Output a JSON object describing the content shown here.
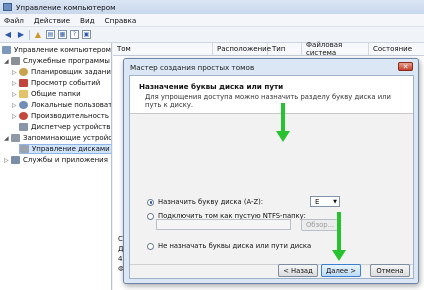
{
  "window": {
    "title": "Управление компьютером"
  },
  "menu": [
    "Файл",
    "Действие",
    "Вид",
    "Справка"
  ],
  "tree": {
    "root": "Управление компьютером (л",
    "items": [
      {
        "label": "Служебные программы"
      },
      {
        "label": "Планировщик заданий"
      },
      {
        "label": "Просмотр событий"
      },
      {
        "label": "Общие папки"
      },
      {
        "label": "Локальные пользовате"
      },
      {
        "label": "Производительность"
      },
      {
        "label": "Диспетчер устройств"
      },
      {
        "label": "Запоминающие устройст"
      },
      {
        "label": "Управление дисками"
      },
      {
        "label": "Службы и приложения"
      }
    ]
  },
  "columns": [
    "Том",
    "Расположение",
    "Тип",
    "Файловая система",
    "Состояние"
  ],
  "lower_info": [
    "С",
    "Д",
    "4(",
    "Ф"
  ],
  "wizard": {
    "title": "Мастер создания простых томов",
    "heading": "Назначение буквы диска или пути",
    "description": "Для упрощения доступа можно назначить разделу букву диска или путь к диску.",
    "options": [
      "Назначить букву диска (A-Z):",
      "Подключить том как пустую NTFS-папку:",
      "Не назначать буквы диска или пути диска"
    ],
    "drive_letter": "E",
    "browse": "Обзор...",
    "buttons": {
      "back": "< Назад",
      "next": "Далее >",
      "cancel": "Отмена"
    }
  }
}
